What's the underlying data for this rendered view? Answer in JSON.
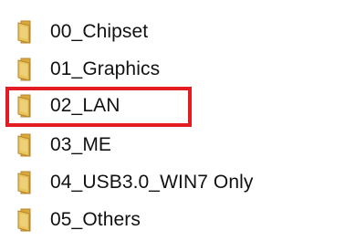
{
  "folders": [
    {
      "name": "00_Chipset",
      "icon": "folder-icon"
    },
    {
      "name": "01_Graphics",
      "icon": "folder-icon"
    },
    {
      "name": "02_LAN",
      "icon": "folder-icon"
    },
    {
      "name": "03_ME",
      "icon": "folder-icon"
    },
    {
      "name": "04_USB3.0_WIN7 Only",
      "icon": "folder-icon"
    },
    {
      "name": "05_Others",
      "icon": "folder-icon"
    }
  ],
  "highlight": {
    "target": "02_LAN",
    "color": "#e31b23"
  },
  "colors": {
    "folder_front": "#e8c45c",
    "folder_back": "#d9a93a",
    "folder_edge": "#b8862b"
  }
}
